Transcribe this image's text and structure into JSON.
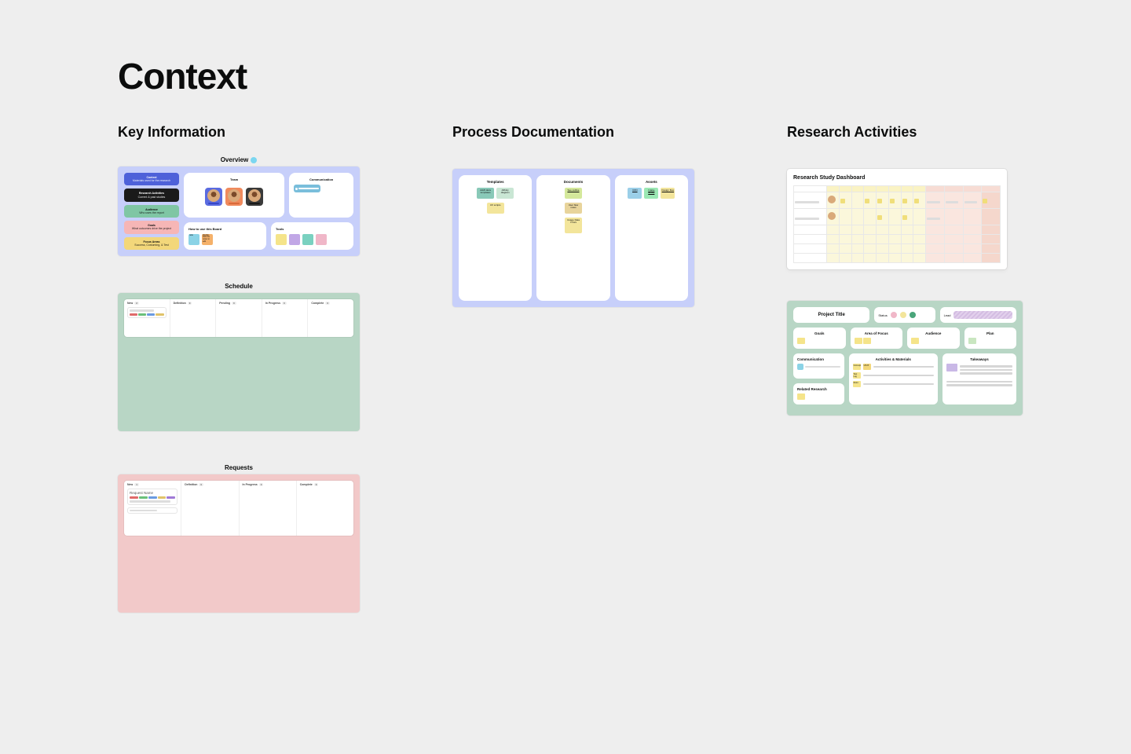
{
  "page_title": "Context",
  "columns": {
    "key_info": "Key Information",
    "process": "Process Documentation",
    "research": "Research Activities"
  },
  "overview": {
    "frame_title": "Overview",
    "nav": [
      {
        "title": "Context",
        "subtitle": "Materials used for the research"
      },
      {
        "title": "Research Activities",
        "subtitle": "Current & past studies"
      },
      {
        "title": "Audience",
        "subtitle": "Who uses the report"
      },
      {
        "title": "Goals",
        "subtitle": "What outcomes drive the project"
      },
      {
        "title": "Focus Areas",
        "subtitle": "Success, Costuming, & Test"
      }
    ],
    "cards": {
      "team": "Team",
      "communication": "Communication",
      "howto": "How to use this Board",
      "tools": "Tools"
    },
    "howto_notes": [
      "note",
      "Double-click the notes to edit"
    ]
  },
  "schedule": {
    "frame_title": "Schedule",
    "columns": [
      {
        "name": "New",
        "count": "2"
      },
      {
        "name": "Definition",
        "count": "0"
      },
      {
        "name": "Pending",
        "count": "0"
      },
      {
        "name": "In Progress",
        "count": "0"
      },
      {
        "name": "Complete",
        "count": "0"
      }
    ]
  },
  "requests": {
    "frame_title": "Requests",
    "columns": [
      {
        "name": "New",
        "count": "1"
      },
      {
        "name": "Definition",
        "count": "0"
      },
      {
        "name": "In Progress",
        "count": "0"
      },
      {
        "name": "Complete",
        "count": "0"
      }
    ],
    "card_title": "Request Name"
  },
  "process": {
    "cols": {
      "templates": "Templates",
      "documents": "Documents",
      "assets": "Assets"
    },
    "templates": [
      "Add'l docs templates",
      "Affinity diagram",
      "UX scripts"
    ],
    "documents": [
      "See outline",
      "User flow notes",
      "Usage Data 7/1/2x"
    ],
    "assets": [
      "CDN",
      "Intake library",
      "Design files"
    ]
  },
  "dashboard": {
    "title": "Research Study Dashboard"
  },
  "project": {
    "title": "Project Title",
    "status_label": "Status",
    "lead_label": "Lead",
    "cards": {
      "goals": "Goals",
      "area": "Area of Focus",
      "audience": "Audience",
      "plan": "Plan",
      "communication": "Communication",
      "activities": "Activities & Materials",
      "takeaways": "Takeaways",
      "related": "Related Research"
    },
    "activity_notes": [
      "Concept",
      "UI/UX",
      "Test Log",
      "Retro"
    ]
  }
}
